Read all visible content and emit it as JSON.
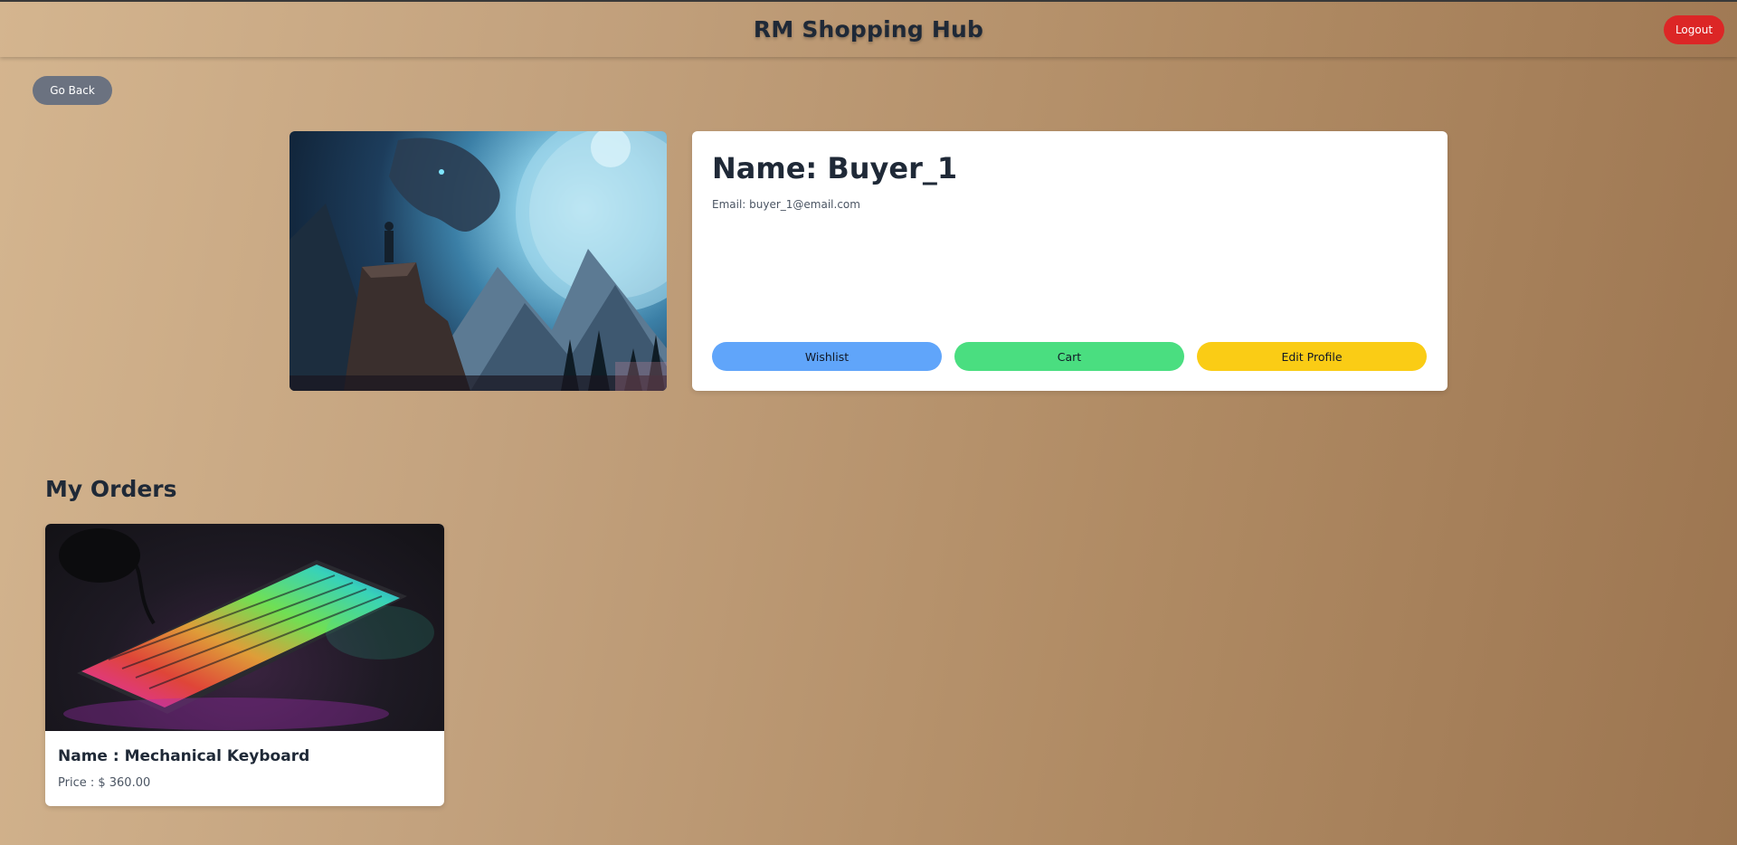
{
  "header": {
    "title": "RM Shopping Hub",
    "logout_label": "Logout"
  },
  "nav": {
    "go_back_label": "Go Back"
  },
  "profile": {
    "image_icon": "wolf-landscape-avatar-image",
    "name_text": "Name: Buyer_1",
    "email_text": "Email: buyer_1@email.com",
    "buttons": {
      "wishlist": "Wishlist",
      "cart": "Cart",
      "edit_profile": "Edit Profile"
    }
  },
  "orders": {
    "heading": "My Orders",
    "items": [
      {
        "image_icon": "rgb-mechanical-keyboard-image",
        "name_text": "Name : Mechanical Keyboard",
        "price_text": "Price : $ 360.00"
      }
    ]
  },
  "colors": {
    "logout": "#dc2626",
    "go_back": "#6b7280",
    "wishlist": "#60a5fa",
    "cart": "#4ade80",
    "edit_profile": "#facc15"
  }
}
